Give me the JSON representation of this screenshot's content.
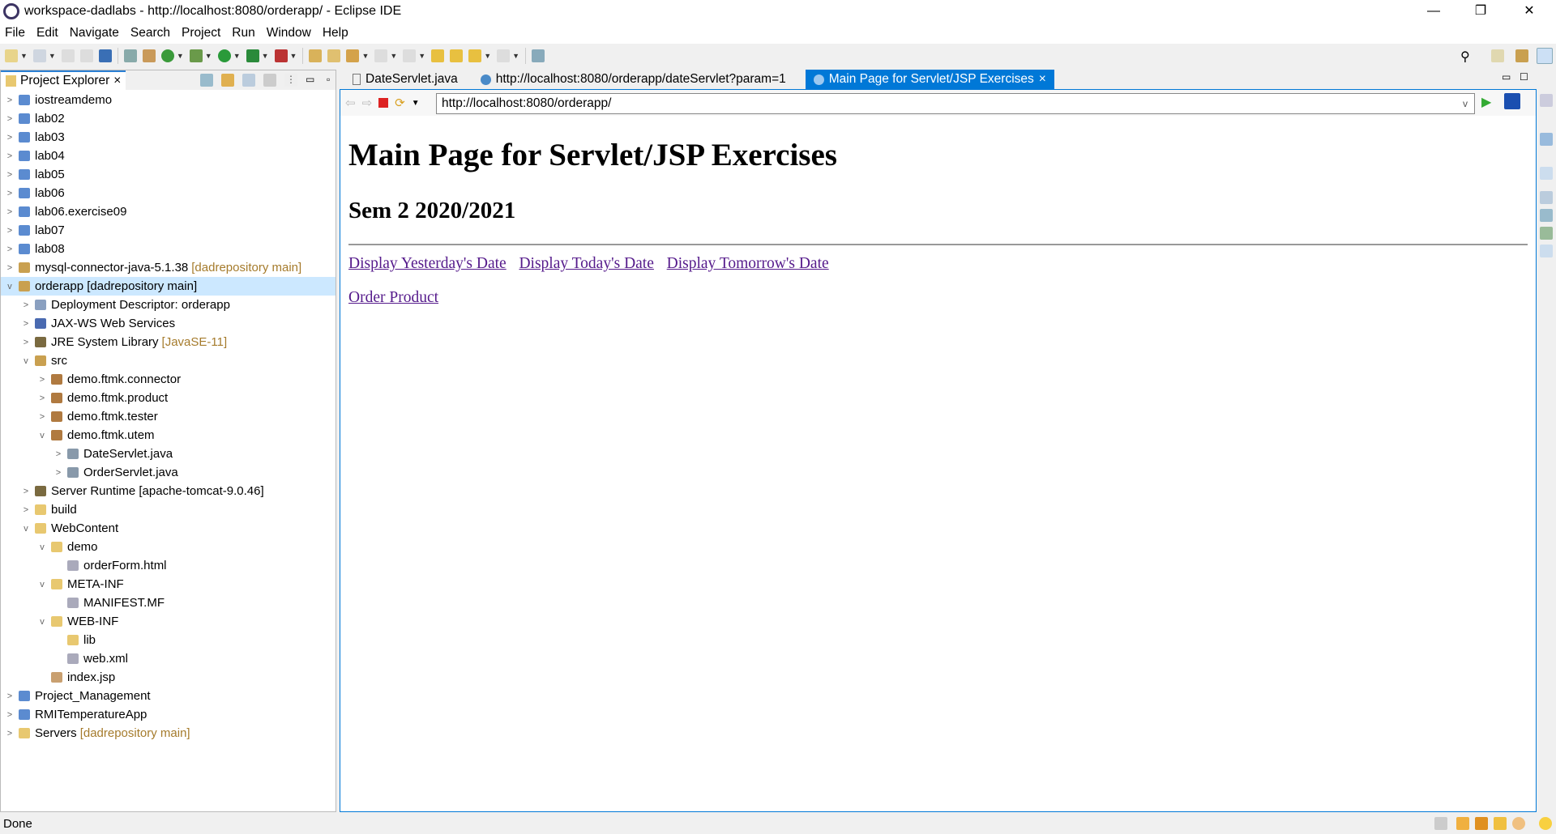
{
  "window": {
    "title": "workspace-dadlabs - http://localhost:8080/orderapp/ - Eclipse IDE",
    "minimize": "—",
    "restore": "❐",
    "close": "✕"
  },
  "menu": [
    "File",
    "Edit",
    "Navigate",
    "Search",
    "Project",
    "Run",
    "Window",
    "Help"
  ],
  "explorer": {
    "tab_label": "Project Explorer",
    "close": "×",
    "items": [
      {
        "level": 0,
        "tw": ">",
        "icon": "project",
        "label": "iostreamdemo"
      },
      {
        "level": 0,
        "tw": ">",
        "icon": "project",
        "label": "lab02"
      },
      {
        "level": 0,
        "tw": ">",
        "icon": "project",
        "label": "lab03"
      },
      {
        "level": 0,
        "tw": ">",
        "icon": "project",
        "label": "lab04"
      },
      {
        "level": 0,
        "tw": ">",
        "icon": "project",
        "label": "lab05"
      },
      {
        "level": 0,
        "tw": ">",
        "icon": "project",
        "label": "lab06"
      },
      {
        "level": 0,
        "tw": ">",
        "icon": "project",
        "label": "lab06.exercise09"
      },
      {
        "level": 0,
        "tw": ">",
        "icon": "project",
        "label": "lab07"
      },
      {
        "level": 0,
        "tw": ">",
        "icon": "project",
        "label": "lab08"
      },
      {
        "level": 0,
        "tw": ">",
        "icon": "repo-project",
        "label": "mysql-connector-java-5.1.38",
        "dec": "[dadrepository main]"
      },
      {
        "level": 0,
        "tw": "v",
        "icon": "repo-project",
        "label": "orderapp [dadrepository main]",
        "selected": true
      },
      {
        "level": 1,
        "tw": ">",
        "icon": "descriptor",
        "label": "Deployment Descriptor: orderapp"
      },
      {
        "level": 1,
        "tw": ">",
        "icon": "webservice",
        "label": "JAX-WS Web Services"
      },
      {
        "level": 1,
        "tw": ">",
        "icon": "library",
        "label": "JRE System Library",
        "dec": "[JavaSE-11]"
      },
      {
        "level": 1,
        "tw": "v",
        "icon": "source-folder",
        "label": "src"
      },
      {
        "level": 2,
        "tw": ">",
        "icon": "package",
        "label": "demo.ftmk.connector"
      },
      {
        "level": 2,
        "tw": ">",
        "icon": "package",
        "label": "demo.ftmk.product"
      },
      {
        "level": 2,
        "tw": ">",
        "icon": "package",
        "label": "demo.ftmk.tester"
      },
      {
        "level": 2,
        "tw": "v",
        "icon": "package",
        "label": "demo.ftmk.utem"
      },
      {
        "level": 3,
        "tw": ">",
        "icon": "java-file",
        "label": "DateServlet.java"
      },
      {
        "level": 3,
        "tw": ">",
        "icon": "java-file",
        "label": "OrderServlet.java"
      },
      {
        "level": 1,
        "tw": ">",
        "icon": "library",
        "label": "Server Runtime [apache-tomcat-9.0.46]"
      },
      {
        "level": 1,
        "tw": ">",
        "icon": "folder",
        "label": "build"
      },
      {
        "level": 1,
        "tw": "v",
        "icon": "folder",
        "label": "WebContent"
      },
      {
        "level": 2,
        "tw": "v",
        "icon": "folder",
        "label": "demo"
      },
      {
        "level": 3,
        "tw": "",
        "icon": "html-file",
        "label": "orderForm.html"
      },
      {
        "level": 2,
        "tw": "v",
        "icon": "folder",
        "label": "META-INF"
      },
      {
        "level": 3,
        "tw": "",
        "icon": "file",
        "label": "MANIFEST.MF"
      },
      {
        "level": 2,
        "tw": "v",
        "icon": "folder",
        "label": "WEB-INF"
      },
      {
        "level": 3,
        "tw": "",
        "icon": "folder",
        "label": "lib"
      },
      {
        "level": 3,
        "tw": "",
        "icon": "xml-file",
        "label": "web.xml"
      },
      {
        "level": 2,
        "tw": "",
        "icon": "jsp-file",
        "label": "index.jsp"
      },
      {
        "level": 0,
        "tw": ">",
        "icon": "project",
        "label": "Project_Management"
      },
      {
        "level": 0,
        "tw": ">",
        "icon": "project",
        "label": "RMITemperatureApp"
      },
      {
        "level": 0,
        "tw": ">",
        "icon": "repo-folder",
        "label": "Servers",
        "dec": "[dadrepository main]"
      }
    ]
  },
  "editor": {
    "tabs": [
      {
        "label": "DateServlet.java",
        "icon": "java-file-icon"
      },
      {
        "label": "http://localhost:8080/orderapp/dateServlet?param=1",
        "icon": "globe-icon"
      },
      {
        "label": "Main Page for Servlet/JSP Exercises",
        "icon": "globe-icon",
        "active": true,
        "close": "×"
      }
    ]
  },
  "browser": {
    "url": "http://localhost:8080/orderapp/",
    "dropdown": "v",
    "go": "▶",
    "page": {
      "h1": "Main Page for Servlet/JSP Exercises",
      "h2": "Sem 2 2020/2021",
      "links": [
        "Display Yesterday's Date",
        "Display Today's Date",
        "Display Tomorrow's Date"
      ],
      "order_link": "Order Product"
    }
  },
  "status": {
    "text": "Done"
  },
  "colors": {
    "accent": "#0078d7",
    "link": "#551a8b",
    "decoration": "#a57b2c"
  }
}
